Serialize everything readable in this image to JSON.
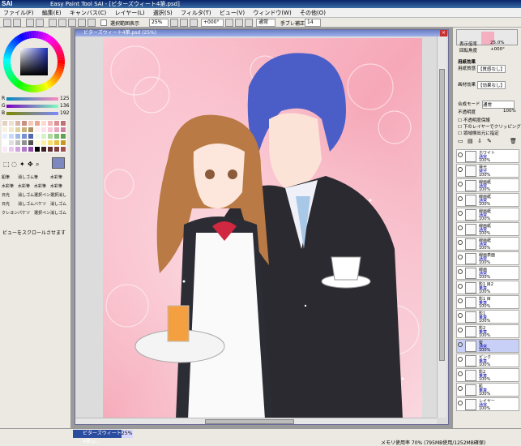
{
  "titlebar": {
    "title": "Easy Paint Tool SAI - [ビターズウィート4第.psd]",
    "logo": "SAI"
  },
  "menu": [
    "ファイル(F)",
    "編集(E)",
    "キャンバス(C)",
    "レイヤー(L)",
    "選択(S)",
    "フィルタ(T)",
    "ビュー(V)",
    "ウィンドウ(W)",
    "その他(O)"
  ],
  "toolbar": {
    "selection_label": "選択範囲表示",
    "zoom": "25%",
    "rotation": "+000°",
    "blend": "通常",
    "stabilizer_label": "手ブレ補正",
    "stabilizer": "14"
  },
  "color": {
    "r_label": "R",
    "g_label": "G",
    "b_label": "B",
    "r": "125",
    "g": "136",
    "b": "192",
    "current": "#7d88c0"
  },
  "swatches": [
    "#e6d0c0",
    "#f0e0d0",
    "#d8b8a8",
    "#c89080",
    "#f2c8b8",
    "#e8a890",
    "#ffd8d0",
    "#f0b8b8",
    "#e09090",
    "#c07070",
    "#f8f0e0",
    "#f0e8c8",
    "#e0d0a0",
    "#c8b078",
    "#a89060",
    "#fff0f0",
    "#ffe0e8",
    "#f8c8d8",
    "#e8a8c0",
    "#d08098",
    "#e8f0ff",
    "#c8d8f8",
    "#a0b8e8",
    "#7890d0",
    "#5068b0",
    "#f0f8e8",
    "#d8f0c8",
    "#b0d8a0",
    "#88c078",
    "#60a050",
    "#ffffff",
    "#e0e0e0",
    "#c0c0c0",
    "#909090",
    "#505050",
    "#fff8d0",
    "#fff0a0",
    "#f8e070",
    "#e8c040",
    "#c89820",
    "#f8e8f8",
    "#e8c8f0",
    "#d0a0e0",
    "#b078c8",
    "#9050a8",
    "#000000",
    "#402020",
    "#603030",
    "#804040",
    "#a05050"
  ],
  "tools": [
    "鉛筆",
    "消しゴム",
    "筆",
    "水彩筆",
    "水彩筆",
    "水彩筆",
    "水彩筆",
    "水彩筆",
    "日光",
    "消しゴム",
    "選択ペン",
    "選択消し",
    "日光",
    "消しゴム",
    "バケツ",
    "消しゴム",
    "クレヨン",
    "パケツ",
    "選択ペン",
    "消しゴム"
  ],
  "status_hint": "ビューをスクロールさせます",
  "document": {
    "title": "ビターズウィート4第.psd (25%)",
    "tab_label": "ビターズウィート4第.p...",
    "tab_zoom": "25%"
  },
  "navigator": {
    "zoom_label": "表示倍率",
    "zoom": "25.0%",
    "rotate_label": "回転角度",
    "rotate": "+000°"
  },
  "paper": {
    "header": "用紙効果",
    "texture_label": "用紙質感",
    "texture": "【質感なし】",
    "effect_label": "画材効果",
    "effect": "【効果なし】"
  },
  "layer_props": {
    "mode_label": "合成モード",
    "mode": "通常",
    "opacity_label": "不透明度",
    "opacity": "100%",
    "opt1": "不透明度保護",
    "opt2": "下のレイヤーでクリッピング",
    "opt3": "領域検出元に指定"
  },
  "layers": [
    {
      "name": "ホワイト",
      "mode": "通常",
      "opacity": "100%"
    },
    {
      "name": "発光",
      "mode": "発光",
      "opacity": "100%"
    },
    {
      "name": "線画紙",
      "mode": "通常",
      "opacity": "100%"
    },
    {
      "name": "線画紙",
      "mode": "通常",
      "opacity": "100%"
    },
    {
      "name": "線画紙",
      "mode": "通常",
      "opacity": "100%"
    },
    {
      "name": "線画紙",
      "mode": "通常",
      "opacity": "100%"
    },
    {
      "name": "線画紙",
      "mode": "通常",
      "opacity": "100%"
    },
    {
      "name": "線画表面",
      "mode": "通常",
      "opacity": "100%"
    },
    {
      "name": "線画",
      "mode": "通常",
      "opacity": "100%"
    },
    {
      "name": "影1 目2",
      "mode": "乗算",
      "opacity": "100%"
    },
    {
      "name": "影1 目",
      "mode": "乗算",
      "opacity": "100%"
    },
    {
      "name": "影1",
      "mode": "乗算",
      "opacity": "100%"
    },
    {
      "name": "影2",
      "mode": "乗算",
      "opacity": "100%"
    },
    {
      "name": "髪",
      "mode": "通常",
      "opacity": "100%"
    },
    {
      "name": "ピンク",
      "mode": "乗算",
      "opacity": "100%"
    },
    {
      "name": "影2",
      "mode": "乗算",
      "opacity": "100%"
    },
    {
      "name": "肌",
      "mode": "乗算",
      "opacity": "100%"
    },
    {
      "name": "レイヤー",
      "mode": "通常",
      "opacity": "100%"
    }
  ],
  "statusbar": {
    "memory": "メモリ使用率 70% (795MB使用/1252MB確保)"
  }
}
